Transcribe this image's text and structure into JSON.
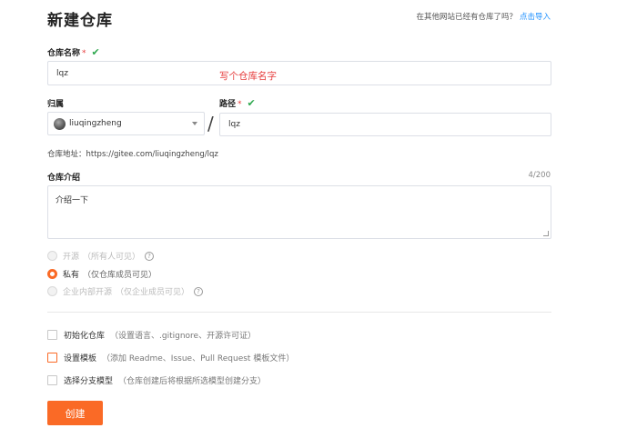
{
  "header": {
    "title": "新建仓库",
    "import_prompt": "在其他网站已经有仓库了吗？",
    "import_link": "点击导入"
  },
  "repo_name": {
    "label": "仓库名称",
    "required_mark": "*",
    "valid_mark": "✔",
    "value": "lqz",
    "annotation": "写个仓库名字"
  },
  "owner": {
    "label": "归属",
    "selected": "liuqingzheng"
  },
  "path": {
    "label": "路径",
    "required_mark": "*",
    "valid_mark": "✔",
    "separator": "/",
    "value": "lqz"
  },
  "address": {
    "text": "仓库地址：https://gitee.com/liuqingzheng/lqz"
  },
  "description": {
    "label": "仓库介绍",
    "counter": "4/200",
    "value": "介绍一下"
  },
  "visibility": {
    "options": [
      {
        "label": "开源",
        "note": "（所有人可见）",
        "selected": false,
        "disabled": true,
        "help": "?"
      },
      {
        "label": "私有",
        "note": "（仅仓库成员可见）",
        "selected": true,
        "disabled": false,
        "help": ""
      },
      {
        "label": "企业内部开源",
        "note": "（仅企业成员可见）",
        "selected": false,
        "disabled": true,
        "help": "?"
      }
    ]
  },
  "options": {
    "items": [
      {
        "label": "初始化仓库",
        "desc": "（设置语言、.gitignore、开源许可证）"
      },
      {
        "label": "设置模板",
        "desc": "（添加 Readme、Issue、Pull Request 模板文件）"
      },
      {
        "label": "选择分支模型",
        "desc": "（仓库创建后将根据所选模型创建分支）"
      }
    ]
  },
  "submit": {
    "label": "创建"
  },
  "colors": {
    "accent": "#fa6a26",
    "link": "#1e90ff",
    "valid": "#2fa84f",
    "required": "#e63e3e"
  }
}
